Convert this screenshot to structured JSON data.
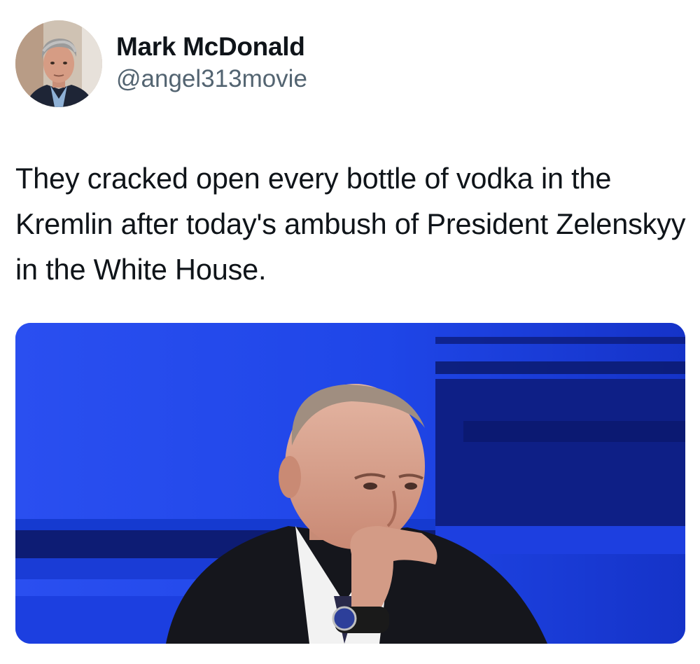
{
  "author": {
    "display_name": "Mark McDonald",
    "handle": "@angel313movie",
    "avatar_icon": "profile-photo-avatar"
  },
  "tweet": {
    "text": "They cracked open every bottle of vodka in the Kremlin after today's ambush of President Zelenskyy in the White House."
  },
  "media": {
    "kind": "photo",
    "icon": "photo-of-man-in-suit-against-blue-background"
  },
  "colors": {
    "text_primary": "#0f1419",
    "text_secondary": "#536471",
    "media_blue": "#1a3ad8",
    "background": "#ffffff"
  }
}
